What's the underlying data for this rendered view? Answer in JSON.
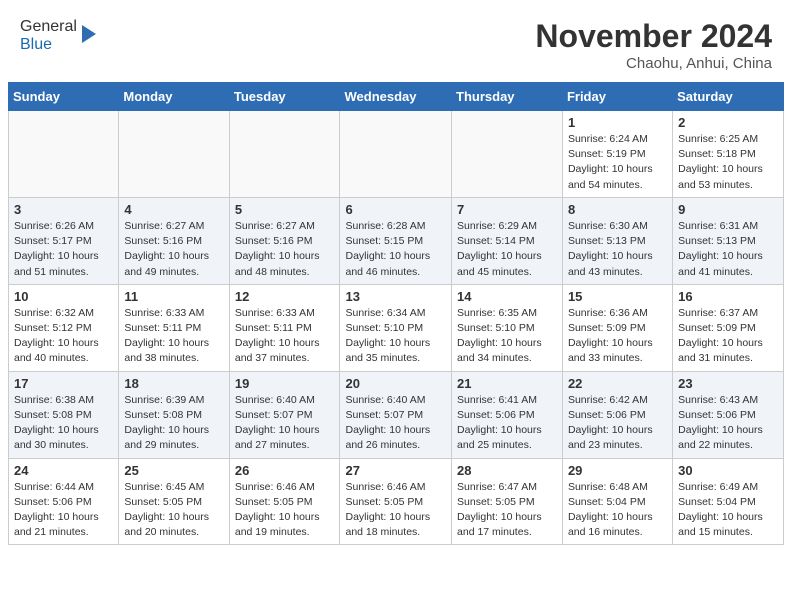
{
  "header": {
    "logo_line1": "General",
    "logo_line2": "Blue",
    "month": "November 2024",
    "location": "Chaohu, Anhui, China"
  },
  "weekdays": [
    "Sunday",
    "Monday",
    "Tuesday",
    "Wednesday",
    "Thursday",
    "Friday",
    "Saturday"
  ],
  "weeks": [
    [
      {
        "day": "",
        "info": ""
      },
      {
        "day": "",
        "info": ""
      },
      {
        "day": "",
        "info": ""
      },
      {
        "day": "",
        "info": ""
      },
      {
        "day": "",
        "info": ""
      },
      {
        "day": "1",
        "info": "Sunrise: 6:24 AM\nSunset: 5:19 PM\nDaylight: 10 hours and 54 minutes."
      },
      {
        "day": "2",
        "info": "Sunrise: 6:25 AM\nSunset: 5:18 PM\nDaylight: 10 hours and 53 minutes."
      }
    ],
    [
      {
        "day": "3",
        "info": "Sunrise: 6:26 AM\nSunset: 5:17 PM\nDaylight: 10 hours and 51 minutes."
      },
      {
        "day": "4",
        "info": "Sunrise: 6:27 AM\nSunset: 5:16 PM\nDaylight: 10 hours and 49 minutes."
      },
      {
        "day": "5",
        "info": "Sunrise: 6:27 AM\nSunset: 5:16 PM\nDaylight: 10 hours and 48 minutes."
      },
      {
        "day": "6",
        "info": "Sunrise: 6:28 AM\nSunset: 5:15 PM\nDaylight: 10 hours and 46 minutes."
      },
      {
        "day": "7",
        "info": "Sunrise: 6:29 AM\nSunset: 5:14 PM\nDaylight: 10 hours and 45 minutes."
      },
      {
        "day": "8",
        "info": "Sunrise: 6:30 AM\nSunset: 5:13 PM\nDaylight: 10 hours and 43 minutes."
      },
      {
        "day": "9",
        "info": "Sunrise: 6:31 AM\nSunset: 5:13 PM\nDaylight: 10 hours and 41 minutes."
      }
    ],
    [
      {
        "day": "10",
        "info": "Sunrise: 6:32 AM\nSunset: 5:12 PM\nDaylight: 10 hours and 40 minutes."
      },
      {
        "day": "11",
        "info": "Sunrise: 6:33 AM\nSunset: 5:11 PM\nDaylight: 10 hours and 38 minutes."
      },
      {
        "day": "12",
        "info": "Sunrise: 6:33 AM\nSunset: 5:11 PM\nDaylight: 10 hours and 37 minutes."
      },
      {
        "day": "13",
        "info": "Sunrise: 6:34 AM\nSunset: 5:10 PM\nDaylight: 10 hours and 35 minutes."
      },
      {
        "day": "14",
        "info": "Sunrise: 6:35 AM\nSunset: 5:10 PM\nDaylight: 10 hours and 34 minutes."
      },
      {
        "day": "15",
        "info": "Sunrise: 6:36 AM\nSunset: 5:09 PM\nDaylight: 10 hours and 33 minutes."
      },
      {
        "day": "16",
        "info": "Sunrise: 6:37 AM\nSunset: 5:09 PM\nDaylight: 10 hours and 31 minutes."
      }
    ],
    [
      {
        "day": "17",
        "info": "Sunrise: 6:38 AM\nSunset: 5:08 PM\nDaylight: 10 hours and 30 minutes."
      },
      {
        "day": "18",
        "info": "Sunrise: 6:39 AM\nSunset: 5:08 PM\nDaylight: 10 hours and 29 minutes."
      },
      {
        "day": "19",
        "info": "Sunrise: 6:40 AM\nSunset: 5:07 PM\nDaylight: 10 hours and 27 minutes."
      },
      {
        "day": "20",
        "info": "Sunrise: 6:40 AM\nSunset: 5:07 PM\nDaylight: 10 hours and 26 minutes."
      },
      {
        "day": "21",
        "info": "Sunrise: 6:41 AM\nSunset: 5:06 PM\nDaylight: 10 hours and 25 minutes."
      },
      {
        "day": "22",
        "info": "Sunrise: 6:42 AM\nSunset: 5:06 PM\nDaylight: 10 hours and 23 minutes."
      },
      {
        "day": "23",
        "info": "Sunrise: 6:43 AM\nSunset: 5:06 PM\nDaylight: 10 hours and 22 minutes."
      }
    ],
    [
      {
        "day": "24",
        "info": "Sunrise: 6:44 AM\nSunset: 5:06 PM\nDaylight: 10 hours and 21 minutes."
      },
      {
        "day": "25",
        "info": "Sunrise: 6:45 AM\nSunset: 5:05 PM\nDaylight: 10 hours and 20 minutes."
      },
      {
        "day": "26",
        "info": "Sunrise: 6:46 AM\nSunset: 5:05 PM\nDaylight: 10 hours and 19 minutes."
      },
      {
        "day": "27",
        "info": "Sunrise: 6:46 AM\nSunset: 5:05 PM\nDaylight: 10 hours and 18 minutes."
      },
      {
        "day": "28",
        "info": "Sunrise: 6:47 AM\nSunset: 5:05 PM\nDaylight: 10 hours and 17 minutes."
      },
      {
        "day": "29",
        "info": "Sunrise: 6:48 AM\nSunset: 5:04 PM\nDaylight: 10 hours and 16 minutes."
      },
      {
        "day": "30",
        "info": "Sunrise: 6:49 AM\nSunset: 5:04 PM\nDaylight: 10 hours and 15 minutes."
      }
    ]
  ]
}
